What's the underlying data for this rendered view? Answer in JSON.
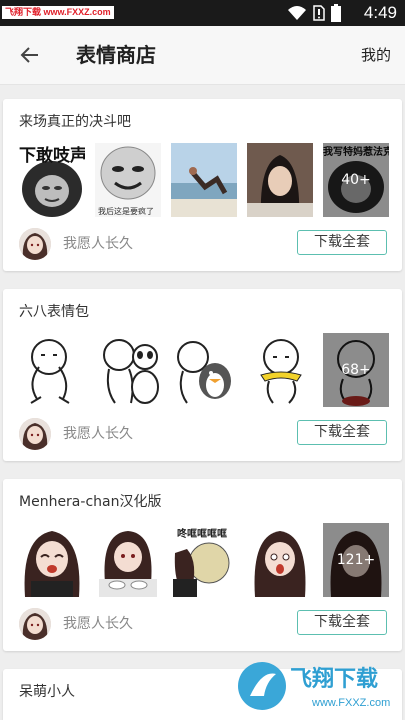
{
  "status_bar": {
    "watermark_badge": "飞翔下载 www.FXXZ.com",
    "time": "4:49",
    "icons": [
      "wifi-icon",
      "no-sim-icon",
      "battery-icon"
    ]
  },
  "app_bar": {
    "back_icon": "arrow-left-icon",
    "title": "表情商店",
    "mine_label": "我的"
  },
  "packs": [
    {
      "title": "来场真正的决斗吧",
      "author": "我愿人长久",
      "download_label": "下载全套",
      "more_count": "40+",
      "thumbs": [
        "panda-meme-text",
        "face-meme",
        "beach-photo",
        "drama-photo",
        "panda-meme-more"
      ],
      "thumb_texts": [
        "下敢吱声",
        "我后这是要疯了",
        "我写特妈惹法克"
      ]
    },
    {
      "title": "六八表情包",
      "author": "我愿人长久",
      "download_label": "下载全套",
      "more_count": "68+",
      "thumbs": [
        "doodle-man",
        "doodle-man-panda",
        "doodle-man-penguin",
        "doodle-man-scarf",
        "doodle-man-more"
      ]
    },
    {
      "title": "Menhera-chan汉化版",
      "author": "我愿人长久",
      "download_label": "下载全套",
      "more_count": "121+",
      "thumbs": [
        "menhera-crying",
        "menhera-eating",
        "menhera-pan",
        "menhera-shock",
        "menhera-more"
      ],
      "thumb_texts": [
        "咚哐哐哐哐"
      ]
    },
    {
      "title": "呆萌小人"
    }
  ],
  "watermark": {
    "brand": "飞翔下载",
    "url": "www.FXXZ.com"
  }
}
